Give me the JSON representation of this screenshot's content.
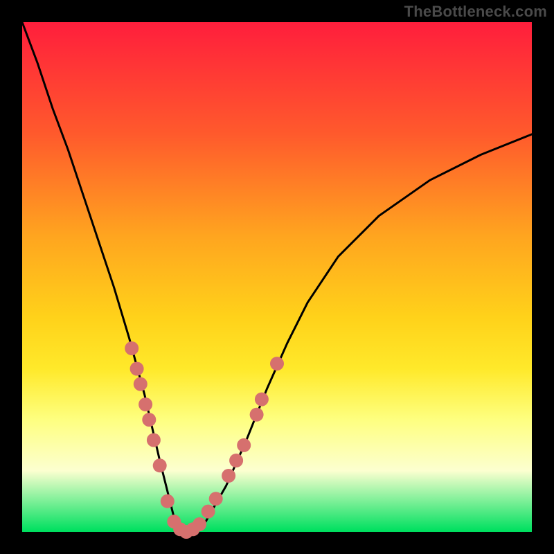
{
  "watermark": "TheBottleneck.com",
  "chart_data": {
    "type": "line",
    "title": "",
    "xlabel": "",
    "ylabel": "",
    "xlim": [
      0,
      100
    ],
    "ylim": [
      0,
      100
    ],
    "grid": false,
    "background_gradient": [
      "#ff1e3c",
      "#ff5a2c",
      "#ffa51f",
      "#ffd21a",
      "#ffe92a",
      "#feff80",
      "#fcffd0",
      "#00e060"
    ],
    "series": [
      {
        "name": "bottleneck-curve",
        "color": "#000000",
        "x": [
          0,
          3,
          6,
          9,
          12,
          15,
          18,
          21,
          24,
          27,
          30,
          33,
          36,
          40,
          44,
          48,
          52,
          56,
          62,
          70,
          80,
          90,
          100
        ],
        "y": [
          100,
          92,
          83,
          75,
          66,
          57,
          48,
          38,
          27,
          14,
          2,
          0,
          2,
          9,
          18,
          28,
          37,
          45,
          54,
          62,
          69,
          74,
          78
        ]
      }
    ],
    "markers": [
      {
        "name": "highlight-points",
        "color": "#d6706e",
        "radius": 10,
        "points": [
          {
            "x": 21.5,
            "y": 36
          },
          {
            "x": 22.5,
            "y": 32
          },
          {
            "x": 23.2,
            "y": 29
          },
          {
            "x": 24.2,
            "y": 25
          },
          {
            "x": 24.9,
            "y": 22
          },
          {
            "x": 25.8,
            "y": 18
          },
          {
            "x": 27.0,
            "y": 13
          },
          {
            "x": 28.5,
            "y": 6
          },
          {
            "x": 29.8,
            "y": 2
          },
          {
            "x": 31.0,
            "y": 0.5
          },
          {
            "x": 32.2,
            "y": 0
          },
          {
            "x": 33.5,
            "y": 0.5
          },
          {
            "x": 34.8,
            "y": 1.5
          },
          {
            "x": 36.5,
            "y": 4
          },
          {
            "x": 38.0,
            "y": 6.5
          },
          {
            "x": 40.5,
            "y": 11
          },
          {
            "x": 42.0,
            "y": 14
          },
          {
            "x": 43.5,
            "y": 17
          },
          {
            "x": 46.0,
            "y": 23
          },
          {
            "x": 47.0,
            "y": 26
          },
          {
            "x": 50.0,
            "y": 33
          }
        ]
      }
    ]
  }
}
